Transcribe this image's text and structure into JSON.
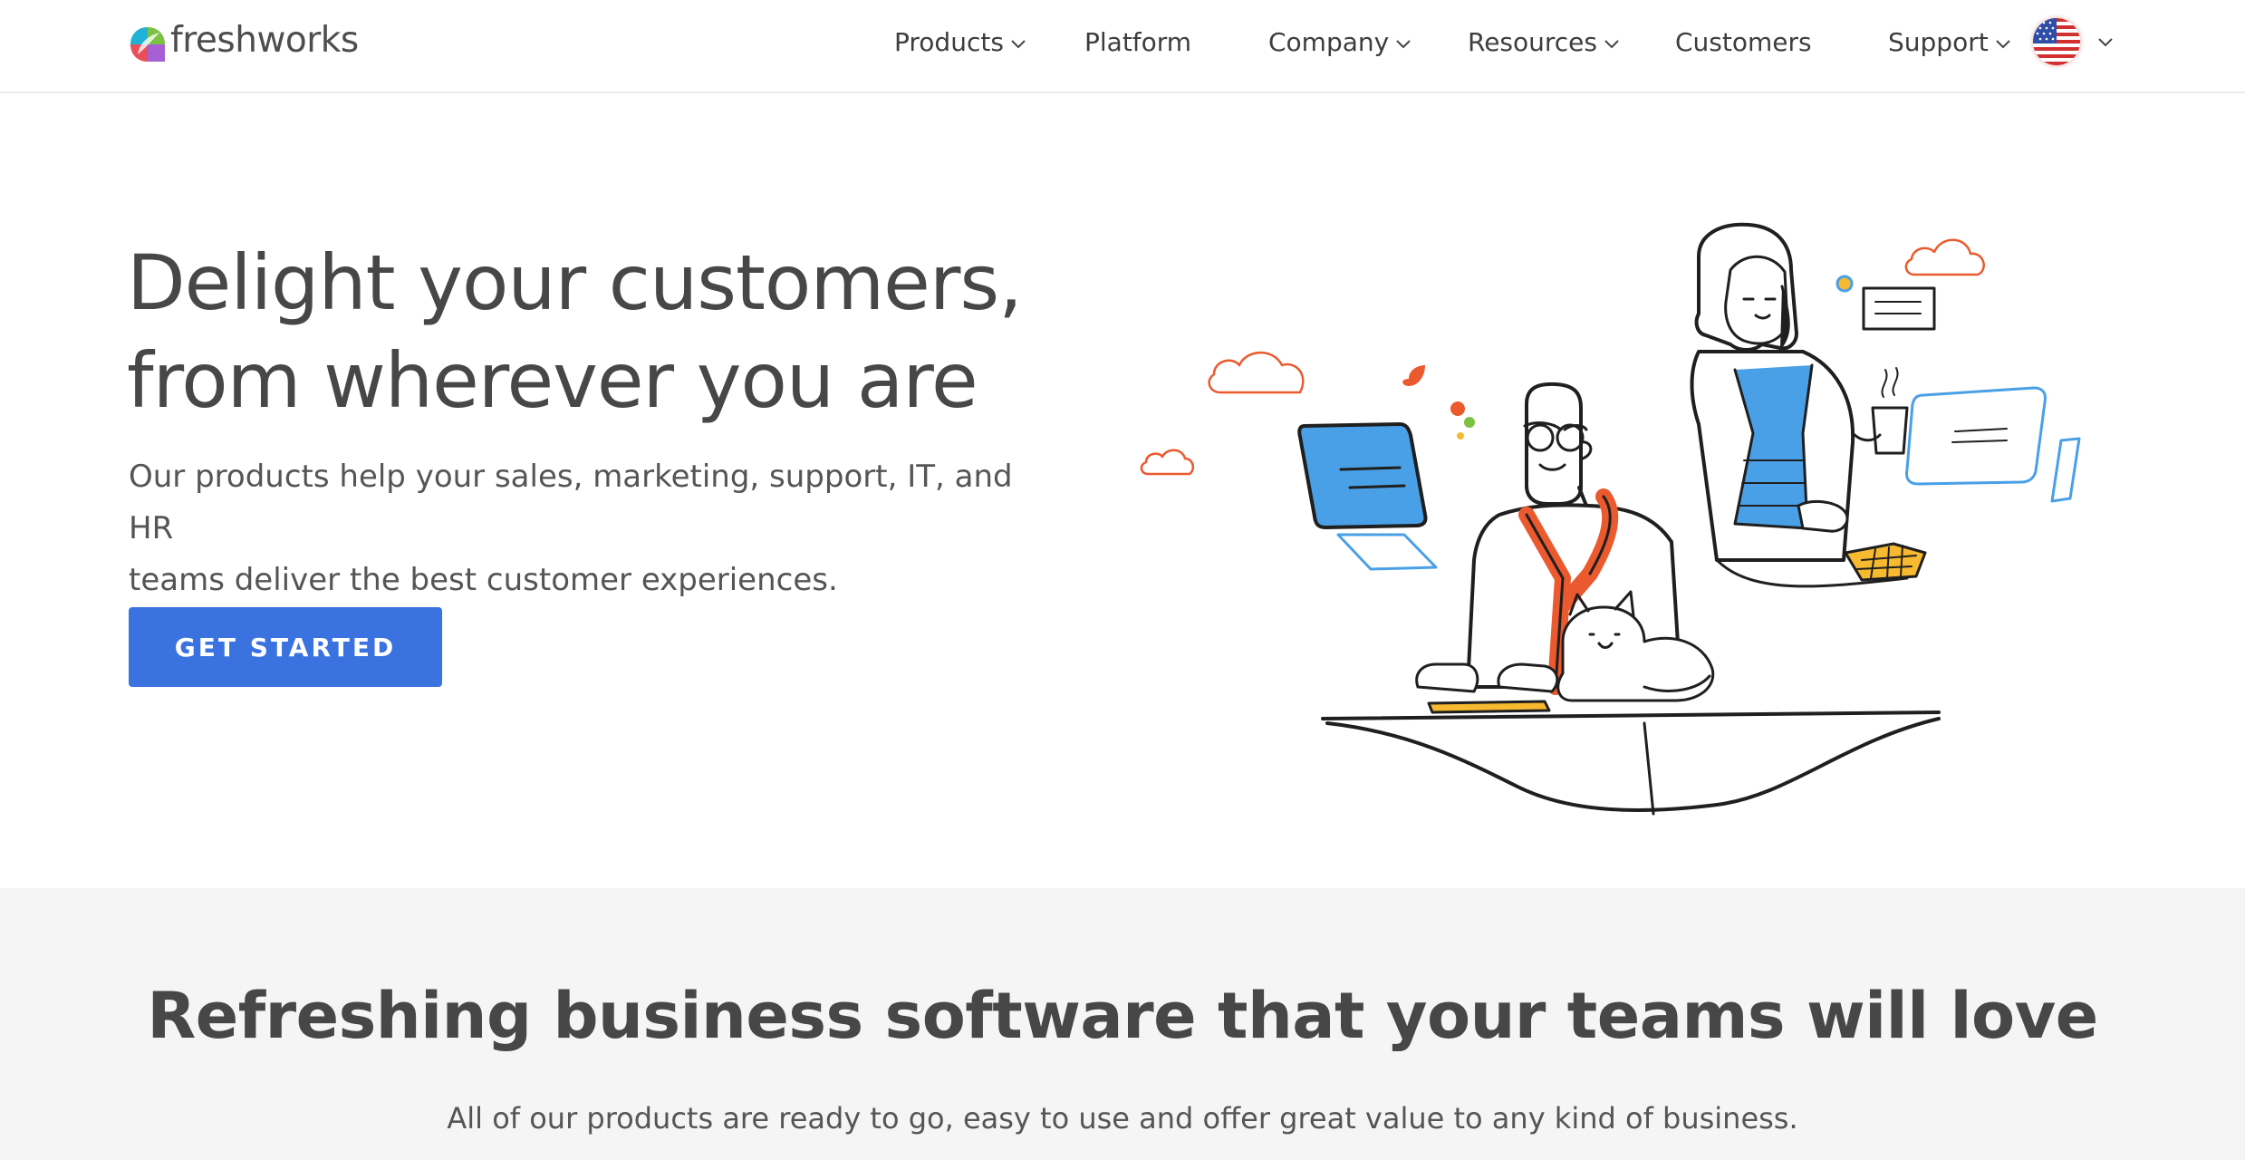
{
  "brand": {
    "name": "freshworks"
  },
  "nav": {
    "products": "Products",
    "platform": "Platform",
    "company": "Company",
    "resources": "Resources",
    "customers": "Customers",
    "support": "Support",
    "region_icon": "us-flag-icon"
  },
  "hero": {
    "title_line1": "Delight your customers,",
    "title_line2": "from wherever you are",
    "subtitle_line1": "Our products help your sales, marketing, support, IT, and HR",
    "subtitle_line2": "teams deliver the best customer experiences.",
    "cta_label": "GET STARTED"
  },
  "section2": {
    "title": "Refreshing business software that your teams will love",
    "subtitle": "All of our products are ready to go, easy to use and offer great value to any kind of business."
  },
  "colors": {
    "accent": "#3a73e0",
    "text": "#474747",
    "illustration_orange": "#ea5a2e",
    "illustration_blue": "#4aa0e6",
    "illustration_yellow": "#f6b930",
    "section_bg": "#f5f5f5"
  }
}
